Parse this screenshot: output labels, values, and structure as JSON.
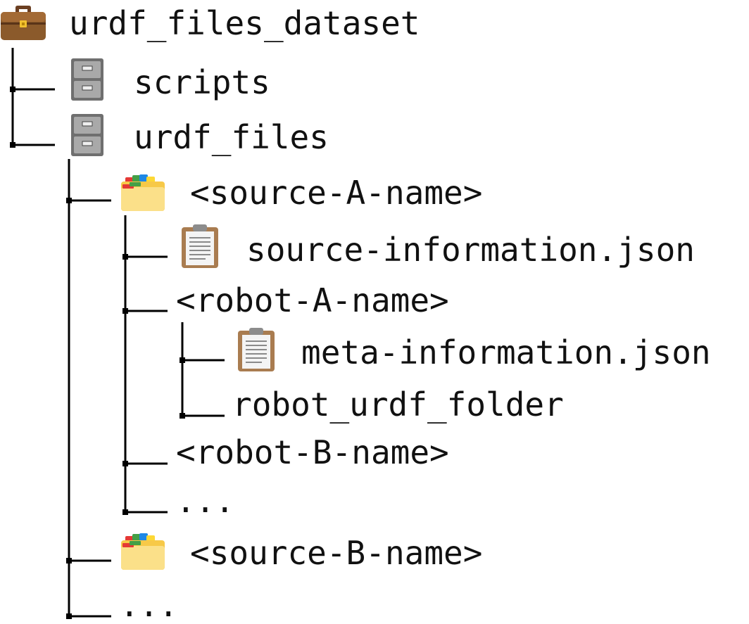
{
  "root": {
    "label": "urdf_files_dataset",
    "icon": "briefcase-icon"
  },
  "items": {
    "scripts": {
      "label": "scripts",
      "icon": "file-cabinet-icon"
    },
    "urdf_files": {
      "label": "urdf_files",
      "icon": "file-cabinet-icon"
    },
    "source_a": {
      "label": "<source-A-name>",
      "icon": "card-index-dividers-icon"
    },
    "source_information": {
      "label": "source-information.json",
      "icon": "clipboard-icon"
    },
    "robot_a": {
      "label": "<robot-A-name>"
    },
    "meta_information": {
      "label": "meta-information.json",
      "icon": "clipboard-icon"
    },
    "robot_urdf_folder": {
      "label": "robot_urdf_folder"
    },
    "robot_b": {
      "label": "<robot-B-name>"
    },
    "ellipsis_robots": {
      "label": "..."
    },
    "source_b": {
      "label": "<source-B-name>",
      "icon": "card-index-dividers-icon"
    },
    "ellipsis_sources": {
      "label": "..."
    }
  }
}
